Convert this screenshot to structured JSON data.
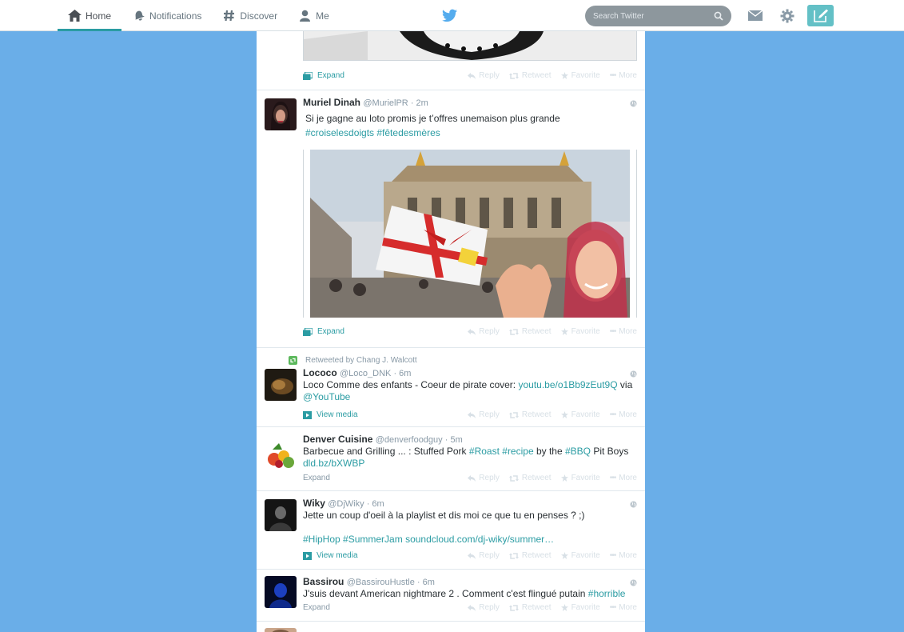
{
  "nav": {
    "items": [
      {
        "label": "Home",
        "icon": "home-icon",
        "active": true
      },
      {
        "label": "Notifications",
        "icon": "bell-icon",
        "active": false
      },
      {
        "label": "Discover",
        "icon": "hashtag-icon",
        "active": false
      },
      {
        "label": "Me",
        "icon": "user-icon",
        "active": false
      }
    ],
    "search_placeholder": "Search Twitter"
  },
  "actions": {
    "reply": "Reply",
    "retweet": "Retweet",
    "favorite": "Favorite",
    "more": "More",
    "expand": "Expand",
    "view_media": "View media"
  },
  "colors": {
    "accent": "#2b9ca3",
    "background": "#6aaee8",
    "compose": "#63c0c6"
  },
  "tweets": [
    {
      "name": "Muriel Dinah",
      "handle": "@MurielPR",
      "time": "2m",
      "text": "Si je gagne au loto promis je t’offres unemaison plus grande",
      "hashtags": "#croiselesdoigts #fêtedesmères"
    },
    {
      "retweeted_by": "Retweeted by Chang J. Walcott",
      "name": "Lococo",
      "handle": "@Loco_DNK",
      "time": "6m",
      "text": "Loco Comme des enfants - Coeur de pirate cover: ",
      "link": "youtu.be/o1Bb9zEut9Q",
      "text2": " via",
      "mention": "@YouTube"
    },
    {
      "name": "Denver Cuisine",
      "handle": "@denverfoodguy",
      "time": "5m",
      "text_a": "Barbecue and Grilling ... : Stuffed Pork ",
      "tag1": "#Roast",
      "tag2": "#recipe",
      "text_b": " by the ",
      "tag3": "#BBQ",
      "text_c": " Pit Boys",
      "link": "dld.bz/bXWBP"
    },
    {
      "name": "Wiky",
      "handle": "@DjWiky",
      "time": "6m",
      "text": "Jette un coup d'oeil à la playlist et dis moi ce que tu en penses ? ;)",
      "tags": "#HipHop #SummerJam",
      "link": "soundcloud.com/dj-wiky/summer…"
    },
    {
      "name": "Bassirou",
      "handle": "@BassirouHustle",
      "time": "6m",
      "text": "J'suis devant American nightmare 2 . Comment c'est flingué putain ",
      "tag": "#horrible"
    }
  ]
}
